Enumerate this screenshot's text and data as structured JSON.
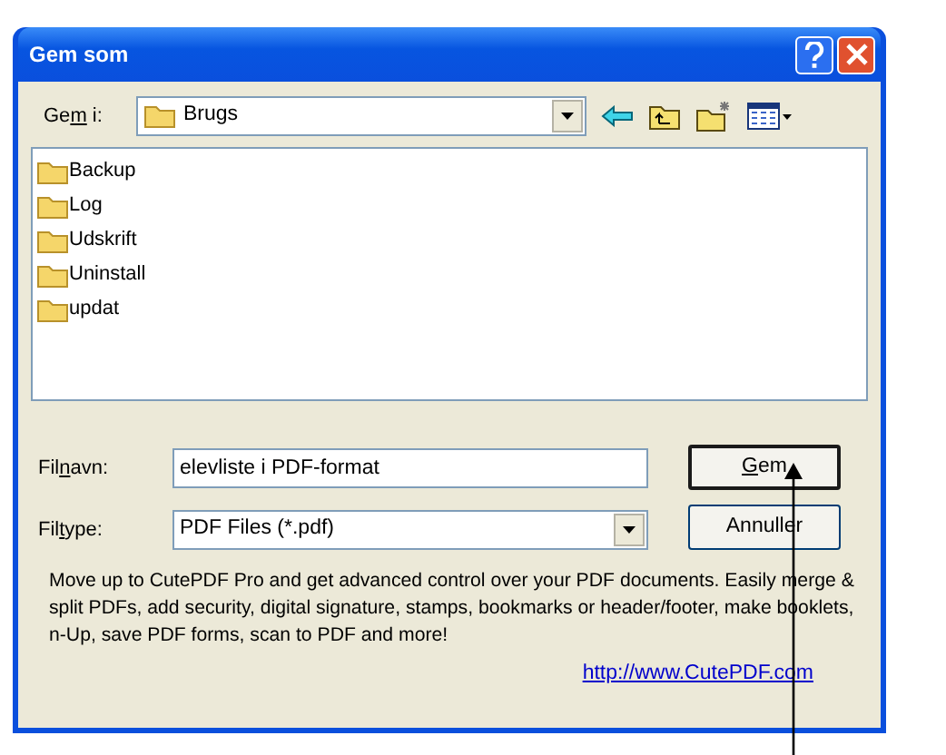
{
  "window": {
    "title": "Gem som"
  },
  "save_in": {
    "label": {
      "before": "Ge",
      "key": "m",
      "after": " i:"
    },
    "value": "Brugs"
  },
  "folders": [
    {
      "name": "Backup"
    },
    {
      "name": "Log"
    },
    {
      "name": "Udskrift"
    },
    {
      "name": "Uninstall"
    },
    {
      "name": "updat"
    }
  ],
  "filename": {
    "label": {
      "before": "Fil",
      "key": "n",
      "after": "avn:"
    },
    "value": "elevliste i PDF-format"
  },
  "filetype": {
    "label": {
      "before": "Fil",
      "key": "t",
      "after": "ype:"
    },
    "value": "PDF Files (*.pdf)"
  },
  "buttons": [
    {
      "label": {
        "key": "G",
        "after": "em"
      },
      "default": true
    },
    {
      "label": {
        "after": "Annuller"
      },
      "default": false
    }
  ],
  "promo": "Move up to CutePDF Pro and get advanced control over your PDF documents. Easily merge & split PDFs, add security, digital signature, stamps, bookmarks or header/footer, make booklets, n-Up, save PDF forms, scan to PDF and more!",
  "link": "http://www.CutePDF.com"
}
